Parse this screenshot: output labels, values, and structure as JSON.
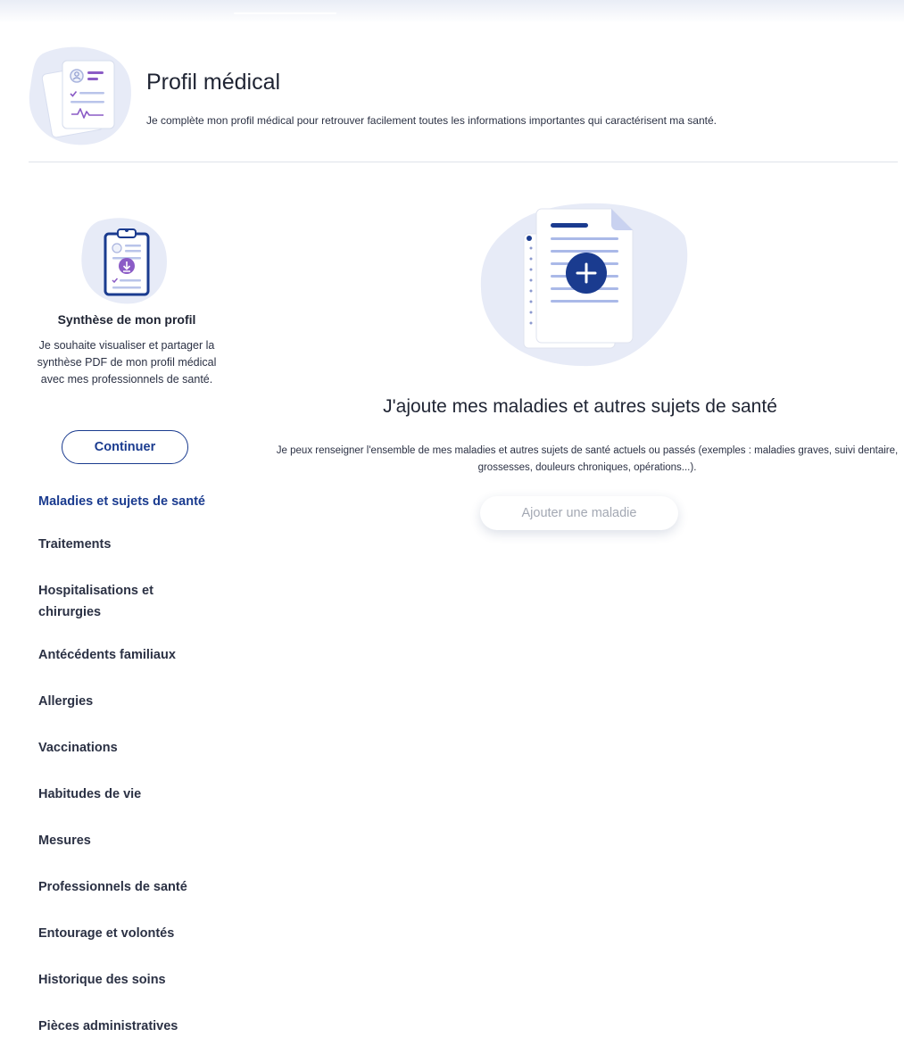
{
  "header": {
    "title": "Profil médical",
    "subtitle": "Je complète mon profil médical pour retrouver facilement toutes les informations importantes qui caractérisent ma santé.",
    "illustration_icon": "medical-records-icon"
  },
  "synthesis": {
    "title": "Synthèse de mon profil",
    "text": "Je souhaite visualiser et partager la synthèse PDF de mon profil médical avec mes professionnels de santé.",
    "button_label": "Continuer",
    "illustration_icon": "clipboard-download-icon"
  },
  "nav": {
    "items": [
      {
        "label": "Maladies et sujets de santé",
        "active": true
      },
      {
        "label": "Traitements"
      },
      {
        "label": "Hospitalisations et chirurgies"
      },
      {
        "label": "Antécédents familiaux"
      },
      {
        "label": "Allergies"
      },
      {
        "label": "Vaccinations"
      },
      {
        "label": "Habitudes de vie"
      },
      {
        "label": "Mesures"
      },
      {
        "label": "Professionnels de santé"
      },
      {
        "label": "Entourage et volontés"
      },
      {
        "label": "Historique des soins"
      },
      {
        "label": "Pièces administratives"
      }
    ]
  },
  "main": {
    "title": "J'ajoute mes maladies et autres sujets de santé",
    "text": "Je peux renseigner l'ensemble de mes maladies et autres sujets de santé actuels ou passés (exemples : maladies graves, suivi dentaire, grossesses, douleurs chroniques, opérations...).",
    "button_label": "Ajouter une maladie",
    "illustration_icon": "document-add-icon"
  },
  "colors": {
    "primary": "#1a3b8f",
    "accent_purple": "#8b5cc6",
    "illustration_bg": "#e7ebf7",
    "illustration_line": "#aab9e8",
    "text": "#1f2433",
    "disabled_text": "#a3a8b3"
  }
}
